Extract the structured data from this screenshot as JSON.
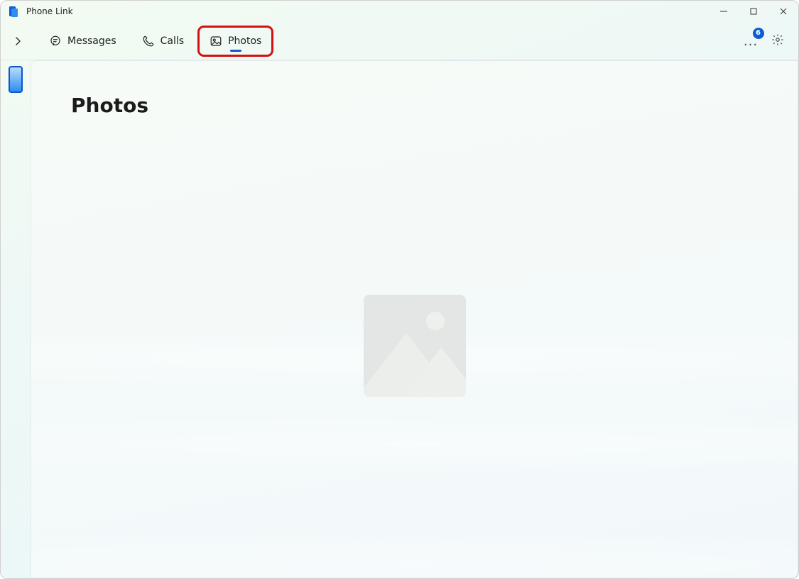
{
  "window": {
    "title": "Phone Link",
    "badge_count": "6"
  },
  "tabs": {
    "messages": "Messages",
    "calls": "Calls",
    "photos": "Photos"
  },
  "page": {
    "heading": "Photos"
  }
}
